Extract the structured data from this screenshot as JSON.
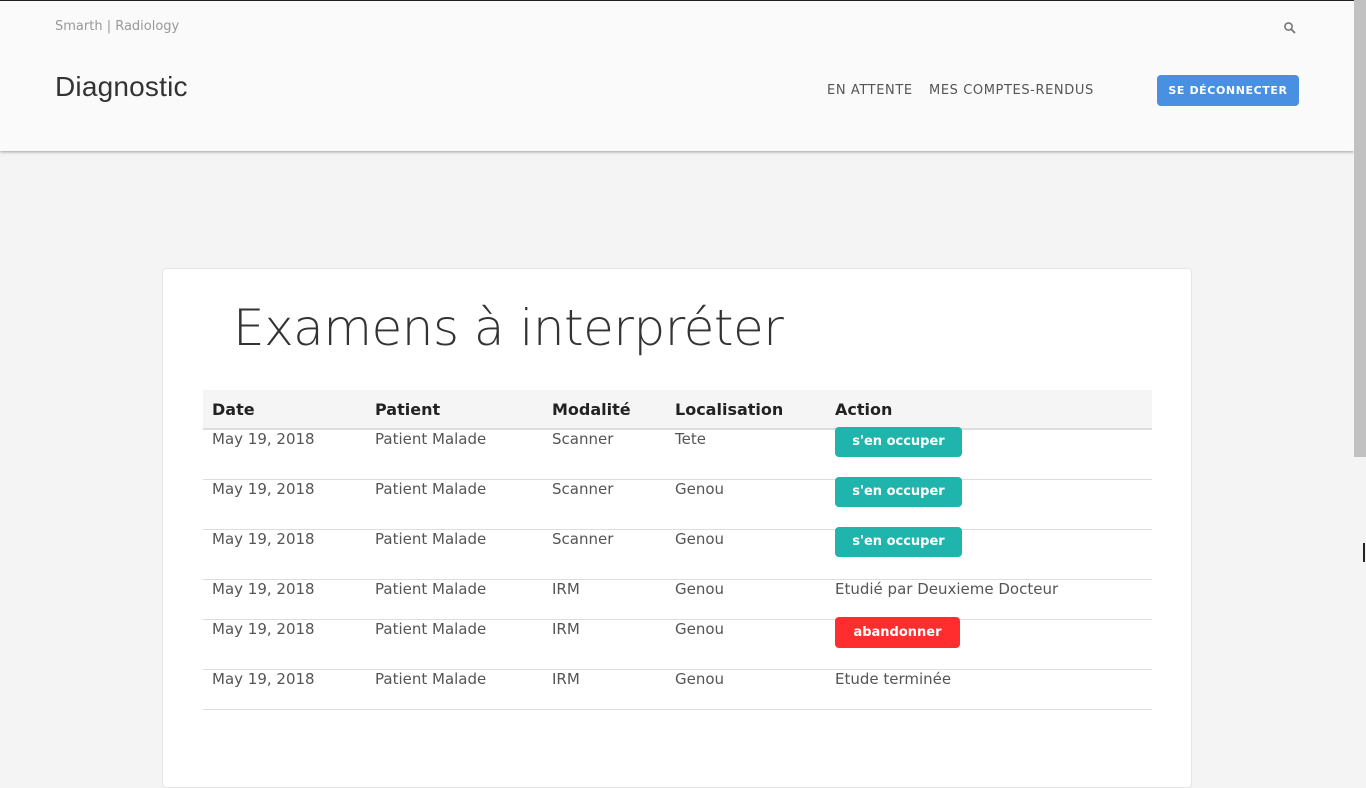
{
  "header": {
    "brand": "Smarth | Radiology",
    "title": "Diagnostic",
    "nav": {
      "pending": "EN ATTENTE",
      "reports": "MES COMPTES-RENDUS"
    },
    "logout": "SE DÉCONNECTER",
    "search_icon": "search-icon"
  },
  "main": {
    "title": "Examens à interpréter",
    "columns": [
      "Date",
      "Patient",
      "Modalité",
      "Localisation",
      "Action"
    ],
    "rows": [
      {
        "date": "May 19, 2018",
        "patient": "Patient Malade",
        "modality": "Scanner",
        "location": "Tete",
        "action": "s'en occuper"
      },
      {
        "date": "May 19, 2018",
        "patient": "Patient Malade",
        "modality": "Scanner",
        "location": "Genou",
        "action": "s'en occuper"
      },
      {
        "date": "May 19, 2018",
        "patient": "Patient Malade",
        "modality": "Scanner",
        "location": "Genou",
        "action": "s'en occuper"
      },
      {
        "date": "May 19, 2018",
        "patient": "Patient Malade",
        "modality": "IRM",
        "location": "Genou",
        "action": "Etudié par Deuxieme Docteur"
      },
      {
        "date": "May 19, 2018",
        "patient": "Patient Malade",
        "modality": "IRM",
        "location": "Genou",
        "action": "abandonner"
      },
      {
        "date": "May 19, 2018",
        "patient": "Patient Malade",
        "modality": "IRM",
        "location": "Genou",
        "action": "Etude terminée"
      }
    ]
  },
  "colors": {
    "primary": "#4a90e2",
    "take": "#1fb5ac",
    "abandon": "#ff2d2d"
  }
}
